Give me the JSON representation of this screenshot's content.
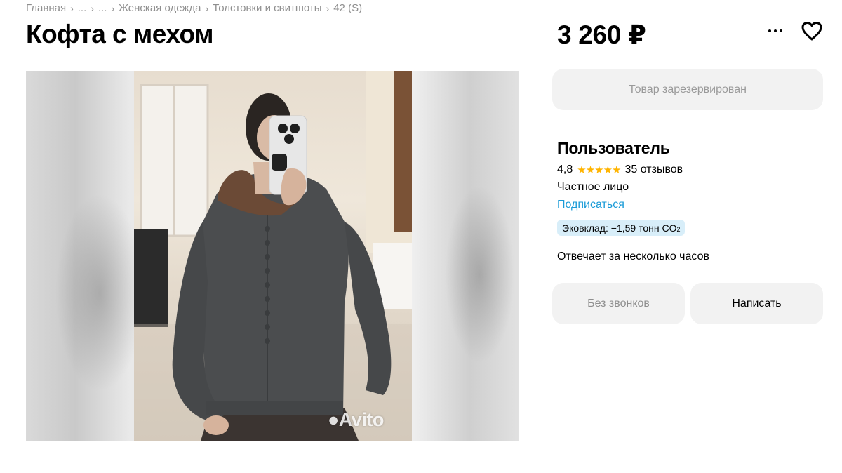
{
  "breadcrumb": {
    "items": [
      "Главная",
      "...",
      "...",
      "Женская одежда",
      "Толстовки и свитшоты",
      "42 (S)"
    ],
    "separator": "›"
  },
  "listing": {
    "title": "Кофта с мехом",
    "price": "3 260 ₽"
  },
  "actions": {
    "more_icon": "more-dots-icon",
    "favorite_icon": "heart-icon"
  },
  "gallery": {
    "watermark": "Avito",
    "watermark_icon": "avito-logo-icon"
  },
  "status": {
    "reserved_label": "Товар зарезервирован"
  },
  "seller": {
    "name": "Пользователь",
    "rating": "4,8",
    "stars": "★★★★★",
    "star_color": "#ffb400",
    "reviews": "35 отзывов",
    "type": "Частное лицо",
    "subscribe_label": "Подписаться",
    "subscribe_color": "#1a9bd7",
    "eco_text": "Эковклад: −1,59 тонн CO",
    "eco_sub": "2",
    "response_time": "Отвечает за несколько часов"
  },
  "contact": {
    "no_calls_label": "Без звонков",
    "write_label": "Написать"
  }
}
